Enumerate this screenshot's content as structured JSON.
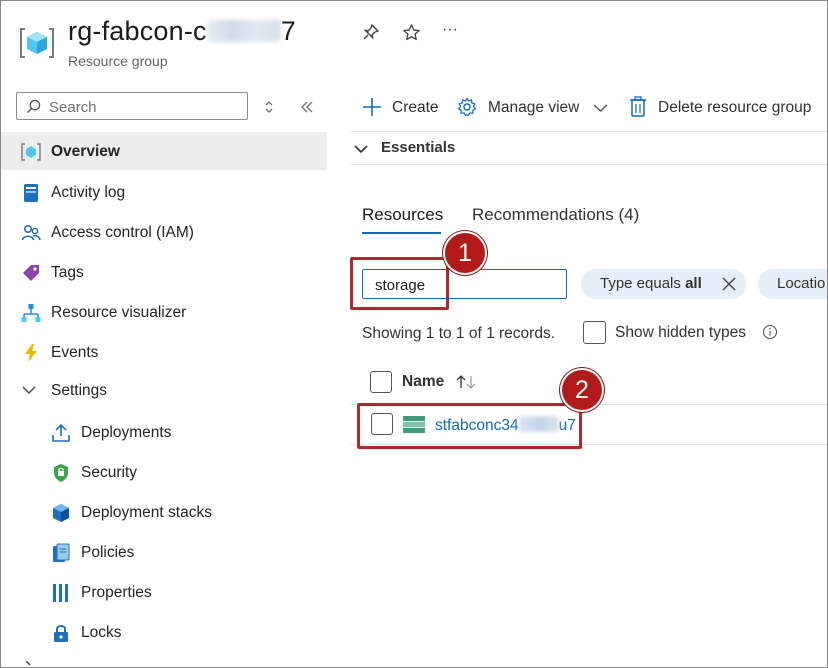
{
  "header": {
    "title_start": "rg-fabcon-c",
    "title_end": "7",
    "subtitle": "Resource group",
    "pin_icon": "pin-icon",
    "star_icon": "star-icon",
    "more_label": "···"
  },
  "sidebar": {
    "search_placeholder": "Search",
    "items": [
      {
        "label": "Overview",
        "icon": "resource-group-icon"
      },
      {
        "label": "Activity log",
        "icon": "activity-log-icon"
      },
      {
        "label": "Access control (IAM)",
        "icon": "people-icon"
      },
      {
        "label": "Tags",
        "icon": "tag-icon"
      },
      {
        "label": "Resource visualizer",
        "icon": "visualizer-icon"
      },
      {
        "label": "Events",
        "icon": "lightning-icon"
      },
      {
        "label": "Settings",
        "icon": "chevron-down-icon"
      },
      {
        "label": "Deployments",
        "icon": "upload-icon"
      },
      {
        "label": "Security",
        "icon": "shield-icon"
      },
      {
        "label": "Deployment stacks",
        "icon": "cube-icon"
      },
      {
        "label": "Policies",
        "icon": "document-icon"
      },
      {
        "label": "Properties",
        "icon": "bars-icon"
      },
      {
        "label": "Locks",
        "icon": "lock-icon"
      }
    ]
  },
  "toolbar": {
    "create_label": "Create",
    "manage_view_label": "Manage view",
    "delete_label": "Delete resource group"
  },
  "essentials_label": "Essentials",
  "tabs": [
    {
      "label": "Resources"
    },
    {
      "label": "Recommendations (4)"
    }
  ],
  "filter": {
    "value": "storage",
    "type_pill_prefix": "Type equals ",
    "type_pill_value": "all",
    "location_pill": "Locatio"
  },
  "records_text": "Showing 1 to 1 of 1 records.",
  "show_hidden_label": "Show hidden types",
  "table": {
    "column_name": "Name",
    "rows": [
      {
        "name_start": "stfabconc34",
        "name_end": "u7"
      }
    ]
  },
  "callouts": [
    "1",
    "2"
  ],
  "colors": {
    "accent": "#0f6cbd",
    "callout": "#b31b1b",
    "nav_active_bg": "#ededed"
  }
}
